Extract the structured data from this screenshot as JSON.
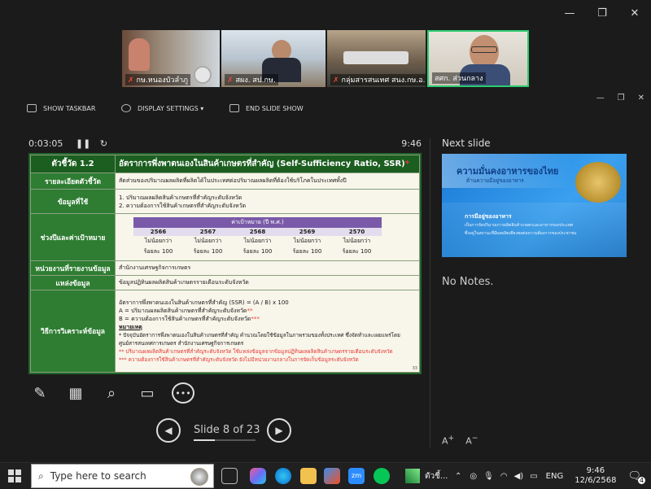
{
  "participants": [
    {
      "name": "กษ.หนองบัวลำภู",
      "muted": true
    },
    {
      "name": "สผง. สป.กษ.",
      "muted": true
    },
    {
      "name": "กลุ่มสารสนเทศ สนง.กษ.อ...",
      "muted": true
    },
    {
      "name": "สศก. ส่วนกลาง",
      "muted": false
    }
  ],
  "toolbar": {
    "taskbar_label": "SHOW TASKBAR",
    "display_label": "DISPLAY SETTINGS ▾",
    "end_label": "END SLIDE SHOW"
  },
  "timer": {
    "elapsed": "0:03:05",
    "clock": "9:46"
  },
  "slide": {
    "indicator_label": "ตัวชี้วัด 1.2",
    "indicator_title": "อัตราการพึ่งพาตนเองในสินค้าเกษตรที่สำคัญ (Self-Sufficiency Ratio, SSR)",
    "title_mark": "*",
    "rows": {
      "detail_label": "รายละเอียดตัวชี้วัด",
      "detail_value": "สัดส่วนของปริมาณผลผลิตที่ผลิตได้ในประเทศต่อปริมาณผลผลิตที่ต้องใช้บริโภคในประเทศทั้งปี",
      "data_label": "ข้อมูลที่ใช้",
      "data_lines": [
        "1. ปริมาณผลผลิตสินค้าเกษตรที่สำคัญระดับจังหวัด",
        "2. ความต้องการใช้สินค้าเกษตรที่สำคัญระดับจังหวัด"
      ],
      "period_label": "ช่วงปีและค่าเป้าหมาย",
      "target_header": "ค่าเป้าหมาย (ปี พ.ศ.)",
      "target_years": [
        "2566",
        "2567",
        "2568",
        "2569",
        "2570"
      ],
      "target_line1": "ไม่น้อยกว่า",
      "target_line2": "ร้อยละ 100",
      "agency_label": "หน่วยงานที่รายงานข้อมูล",
      "agency_value": "สำนักงานเศรษฐกิจการเกษตร",
      "source_label": "แหล่งข้อมูล",
      "source_value": "ข้อมูลปฏิทินผลผลิตสินค้าเกษตรรายเดือนระดับจังหวัด",
      "method_label": "วิธีการวิเคราะห์ข้อมูล",
      "method_lines": [
        "อัตราการพึ่งพาตนเองในสินค้าเกษตรที่สำคัญ (SSR) = (A / B) x 100",
        "A = ปริมาณผลผลิตสินค้าเกษตรที่สำคัญระดับจังหวัด",
        "B = ความต้องการใช้สินค้าเกษตรที่สำคัญระดับจังหวัด"
      ],
      "method_marks": [
        "",
        "**",
        "***"
      ],
      "note_title": "หมายเหตุ",
      "notes": [
        "* ปัจจุบันอัตราการพึ่งพาตนเองในสินค้าเกษตรที่สำคัญ คำนวณโดยใช้ข้อมูลในภาพรวมของทั้งประเทศ ซึ่งจัดทำและเผยแพร่โดย",
        "ศูนย์สารสนเทศการเกษตร สำนักงานเศรษฐกิจการเกษตร",
        "** ปริมาณผลผลิตสินค้าเกษตรที่สำคัญระดับจังหวัด ใช้แหล่งข้อมูลจากข้อมูลปฏิทินผลผลิตสินค้าเกษตรรายเดือนระดับจังหวัด",
        "*** ความต้องการใช้สินค้าเกษตรที่สำคัญระดับจังหวัด ยังไม่มีหน่วยงานกลางในการจัดเก็บข้อมูลระดับจังหวัด"
      ]
    },
    "page_number": "33"
  },
  "navigation": {
    "slide_label": "Slide 8 of 23",
    "progress": 0.348
  },
  "next_slide": {
    "heading": "Next slide",
    "title": "ความมั่นคงอาหารของไทย",
    "subtitle": "ด้านความมีอยู่ของอาหาร",
    "point_title": "การมีอยู่ของอาหาร",
    "point_line1": "เป็นการจัดปริมาณการผลิตสินค้าเกษตรและอาหารของประเทศ",
    "point_line2": "ซึ่งอยู่ในสถานะที่มีผลผลิตเพียงพอต่อความต้องการของประชาชน"
  },
  "notes_text": "No Notes.",
  "taskbar": {
    "search_placeholder": "Type here to search",
    "pinned_label": "ตัวชี้...",
    "lang": "ENG",
    "time": "9:46",
    "date": "12/6/2568",
    "notif_count": "4"
  },
  "colors": {
    "slide_green": "#2e7d32",
    "accent_purple": "#7a5aa8",
    "next_blue": "#1b7ad6",
    "active_speaker": "#2ecc71"
  }
}
